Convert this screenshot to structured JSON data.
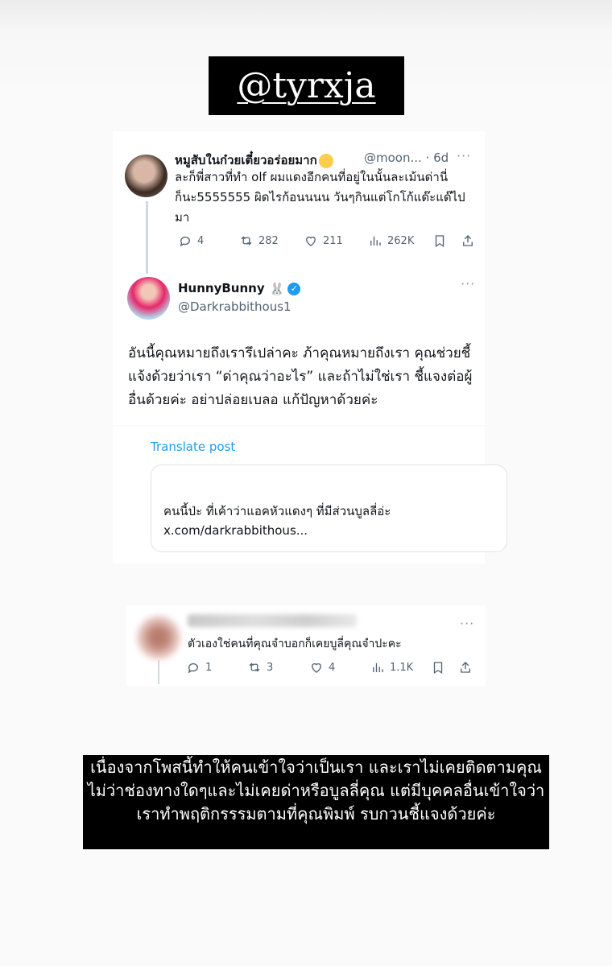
{
  "header": {
    "label": "@tyrxja"
  },
  "post1": {
    "name": "หมูสับในก๋วยเตี๋ยวอร่อยมาก",
    "emoji": "face-emoji",
    "handle_time": "@moon... · 6d",
    "more": "···",
    "body": "ละก็พี่สาวที่ทำ olf ผมแดงอีกคนที่อยู่ในนั้นละเม้นด่านี่ ก็นะ5555555 ผิดไรก้อนนนน วันๆกินแต่โกโก้แด๊ะแด๊ไปมา",
    "replies": "4",
    "reposts": "282",
    "likes": "211",
    "views": "262K"
  },
  "post2": {
    "name": "HunnyBunny",
    "bunny": "🐰",
    "verified": "✓",
    "handle": "@Darkrabbithous1",
    "more": "···",
    "body": "อันนี้คุณหมายถึงเรารึเปล่าคะ ภ้าคุณหมายถึงเรา คุณช่วยชี้แจ้งด้วยว่าเรา “ด่าคุณว่าอะไร” และถ้าไม่ใช่เรา ชี้แจงต่อผู้อื่นด้วยค่ะ อย่าปล่อยเบลอ แก้ปัญหาด้วยค่ะ",
    "translate": "Translate post",
    "quote": "คนนี้ป่ะ ที่เค้าว่าแอคหัวแดงๆ ที่มีส่วนบูลลี่อ่ะ x.com/darkrabbithous..."
  },
  "post3": {
    "more": "···",
    "body": "ตัวเองใช่คนที่คุณจำบอกก็เคยบูลี่คุณจำปะคะ",
    "replies": "1",
    "reposts": "3",
    "likes": "4",
    "views": "1.1K"
  },
  "notice": {
    "text": "เนื่องจากโพสนี้ทำให้คนเข้าใจว่าเป็นเรา และเราไม่เคยติดตามคุณไม่ว่าช่องทางใดๆและไม่เคยด่าหรือบูลลี่คุณ แต่มีบุคคลอื่นเข้าใจว่า เราทำพฤติกรรรมตามที่คุณพิมพ์ รบกวนชี้แจงด้วยค่ะ"
  }
}
